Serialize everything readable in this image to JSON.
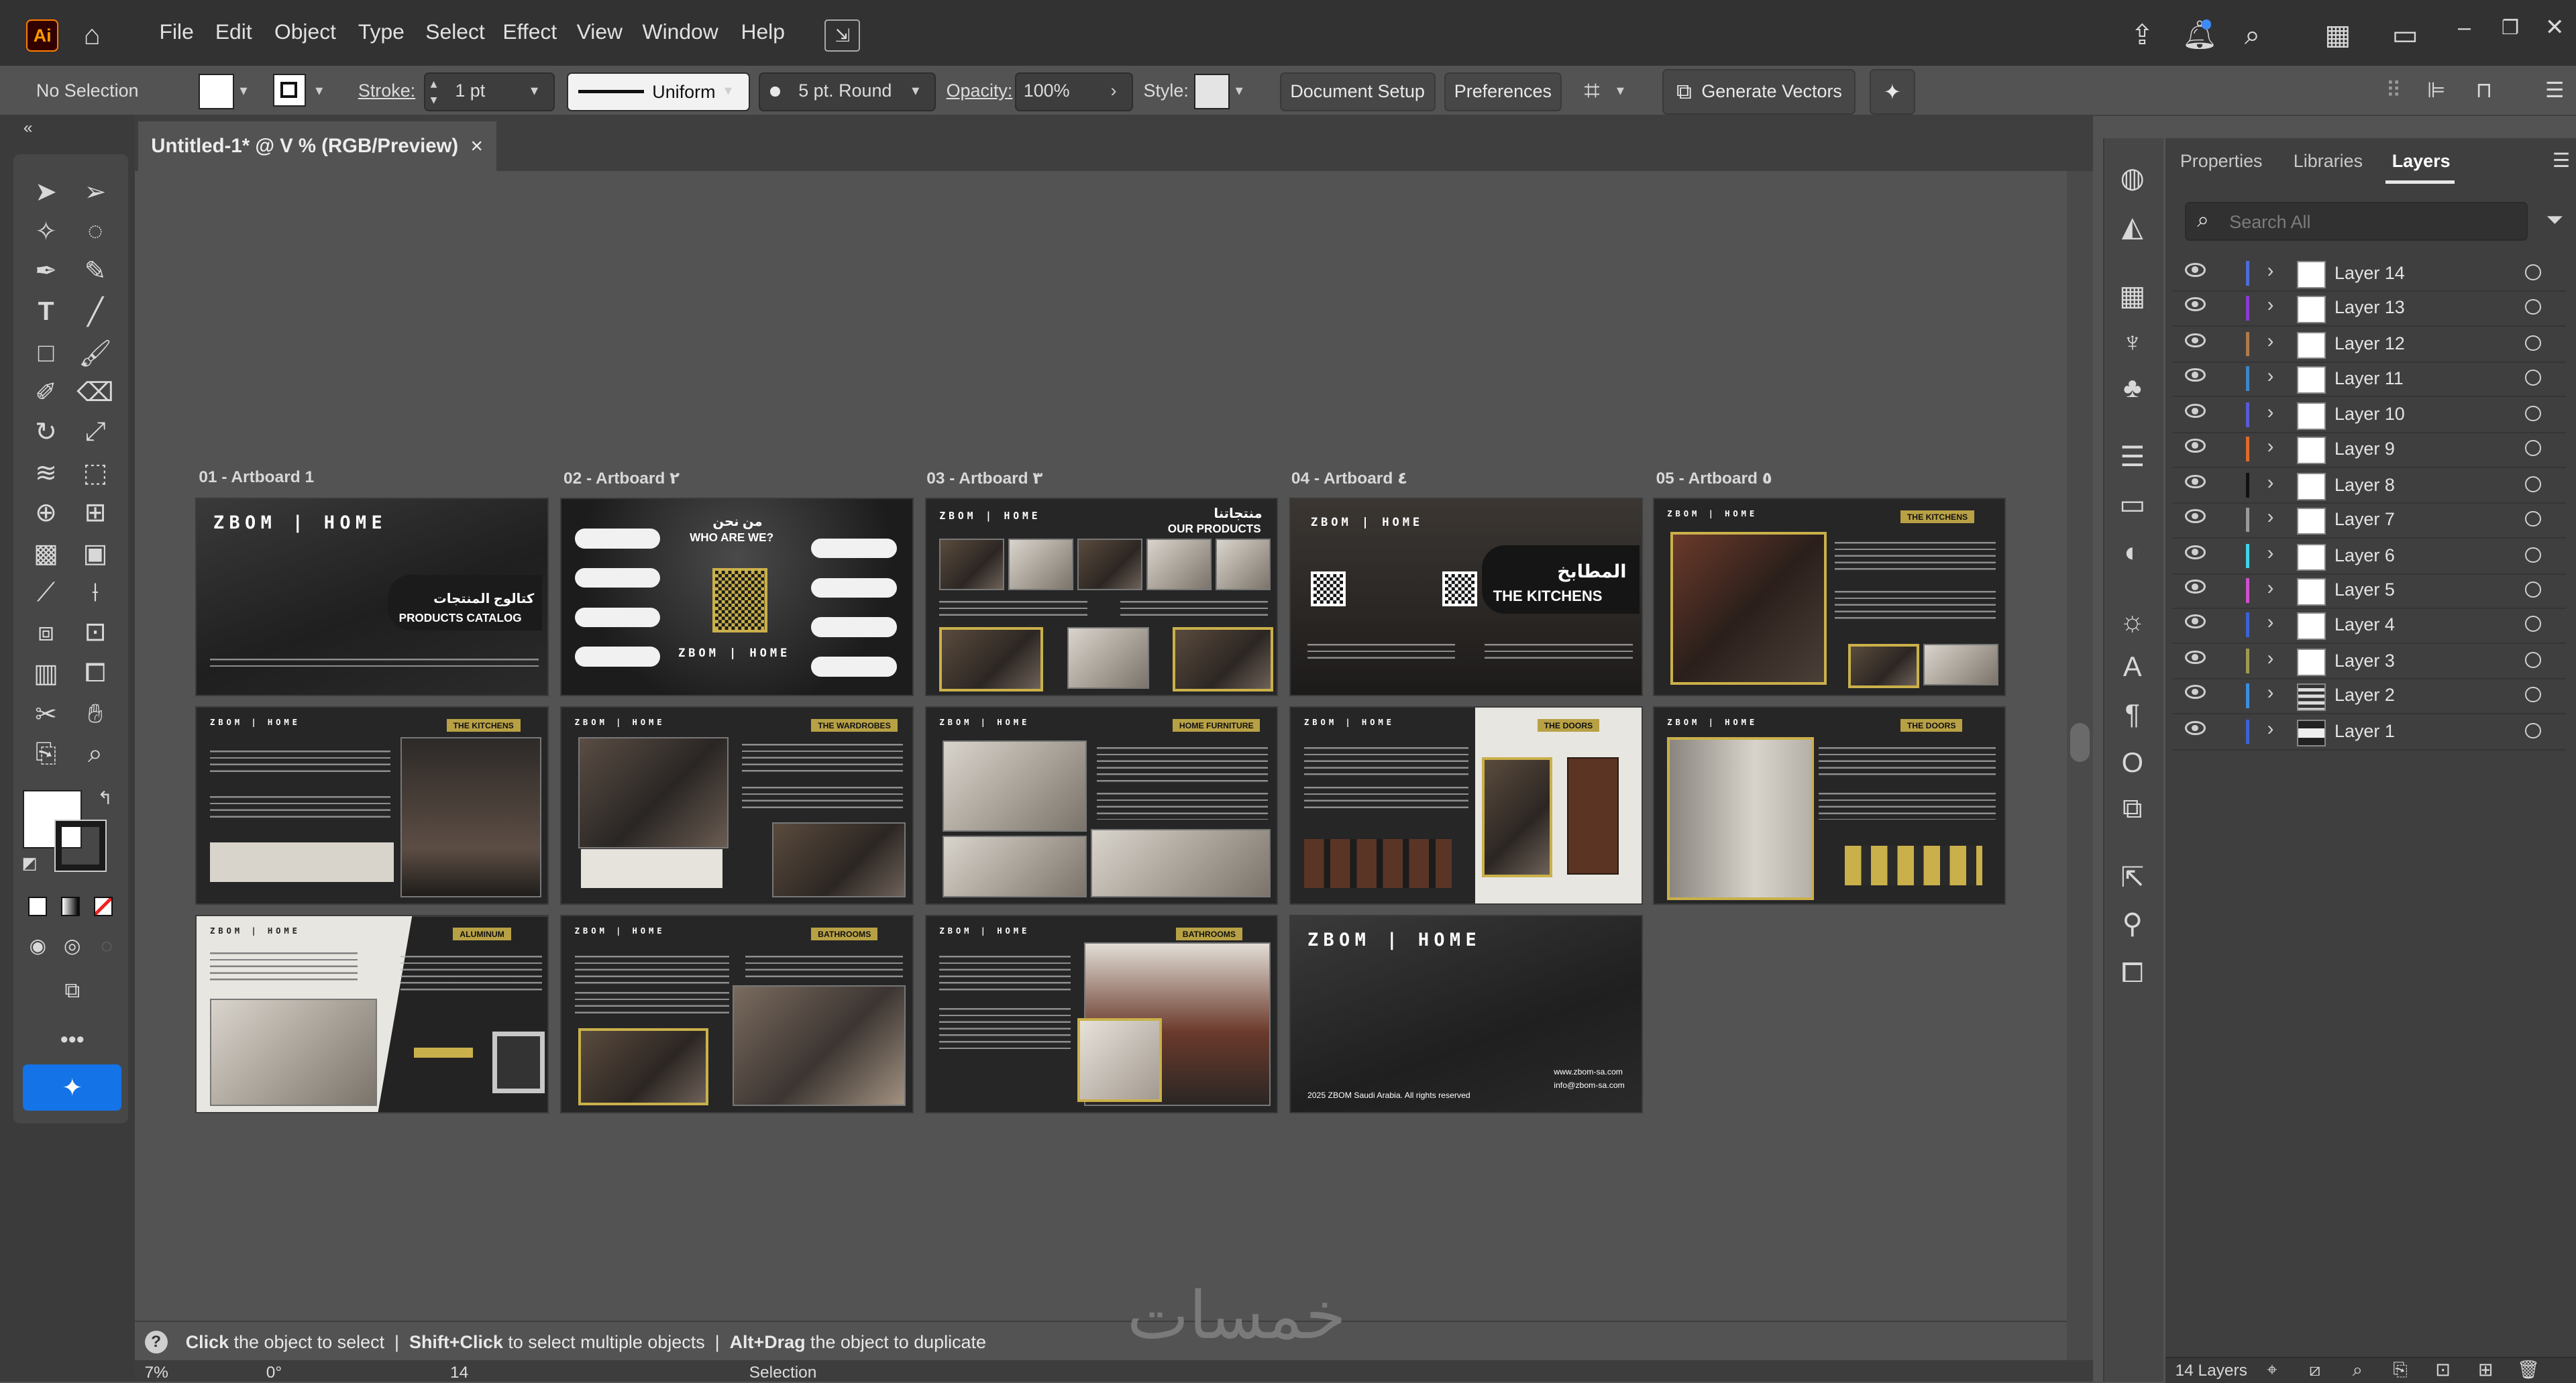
{
  "menubar": {
    "app_logo": "Ai",
    "items": [
      "File",
      "Edit",
      "Object",
      "Type",
      "Select",
      "Effect",
      "View",
      "Window",
      "Help"
    ]
  },
  "controlbar": {
    "selection": "No Selection",
    "stroke_label": "Stroke:",
    "stroke_value": "1 pt",
    "profile": "Uniform",
    "brush": "5 pt. Round",
    "opacity_label": "Opacity:",
    "opacity_value": "100%",
    "style_label": "Style:",
    "document_setup": "Document Setup",
    "preferences": "Preferences",
    "generate_vectors": "Generate Vectors"
  },
  "document": {
    "tab_title": "Untitled-1* @ V % (RGB/Preview)",
    "close": "×"
  },
  "artboards": [
    {
      "label": "01 - Artboard 1"
    },
    {
      "label": "02 - Artboard ٢"
    },
    {
      "label": "03 - Artboard ٣"
    },
    {
      "label": "04 - Artboard ٤"
    },
    {
      "label": "05 - Artboard ٥"
    }
  ],
  "artboard_content": {
    "brand": "ZBOM | HOME",
    "catalog_ar": "كتالوج المنتجات",
    "catalog_en": "PRODUCTS CATALOG",
    "who_ar": "من نحن",
    "who_en": "WHO ARE WE?",
    "products_ar": "منتجاتنا",
    "products_en": "OUR PRODUCTS",
    "kitchens_ar": "المطابخ",
    "kitchens_en": "THE KITCHENS",
    "tag_kitchens": "THE KITCHENS",
    "tag_wardrobes": "THE WARDROBES",
    "tag_doors": "THE DOORS",
    "tag_aluminum": "ALUMINUM",
    "tag_bathrooms": "BATHROOMS",
    "tag_home_furniture": "HOME FURNITURE",
    "copyright": "2025 ZBOM Saudi Arabia. All rights reserved",
    "website": "www.zbom-sa.com",
    "email": "info@zbom-sa.com"
  },
  "statusbar": {
    "help_text_1": "Click",
    "help_text_2": "the object to select",
    "help_text_3": "Shift+Click",
    "help_text_4": "to select multiple objects",
    "help_text_5": "Alt+Drag",
    "help_text_6": "the object to duplicate",
    "zoom": "7%",
    "rotation": "0°",
    "artboard_num": "14",
    "mode": "Selection"
  },
  "panel": {
    "tabs": [
      "Properties",
      "Libraries",
      "Layers"
    ],
    "search_placeholder": "Search All",
    "layers": [
      {
        "name": "Layer 14",
        "color": "#4c6ed8"
      },
      {
        "name": "Layer 13",
        "color": "#8a3bd1"
      },
      {
        "name": "Layer 12",
        "color": "#b07a4a"
      },
      {
        "name": "Layer 11",
        "color": "#3c86c9"
      },
      {
        "name": "Layer 10",
        "color": "#5a5ad6"
      },
      {
        "name": "Layer 9",
        "color": "#e06a2a"
      },
      {
        "name": "Layer 8",
        "color": "#111111"
      },
      {
        "name": "Layer 7",
        "color": "#9a9a9a"
      },
      {
        "name": "Layer 6",
        "color": "#40d4e8"
      },
      {
        "name": "Layer 5",
        "color": "#d04fd0"
      },
      {
        "name": "Layer 4",
        "color": "#3b62d6"
      },
      {
        "name": "Layer 3",
        "color": "#9f9a52"
      },
      {
        "name": "Layer 2",
        "color": "#3a8fe0"
      },
      {
        "name": "Layer 1",
        "color": "#3b62d6"
      }
    ],
    "footer": "14 Layers"
  },
  "watermark": "خمسات"
}
